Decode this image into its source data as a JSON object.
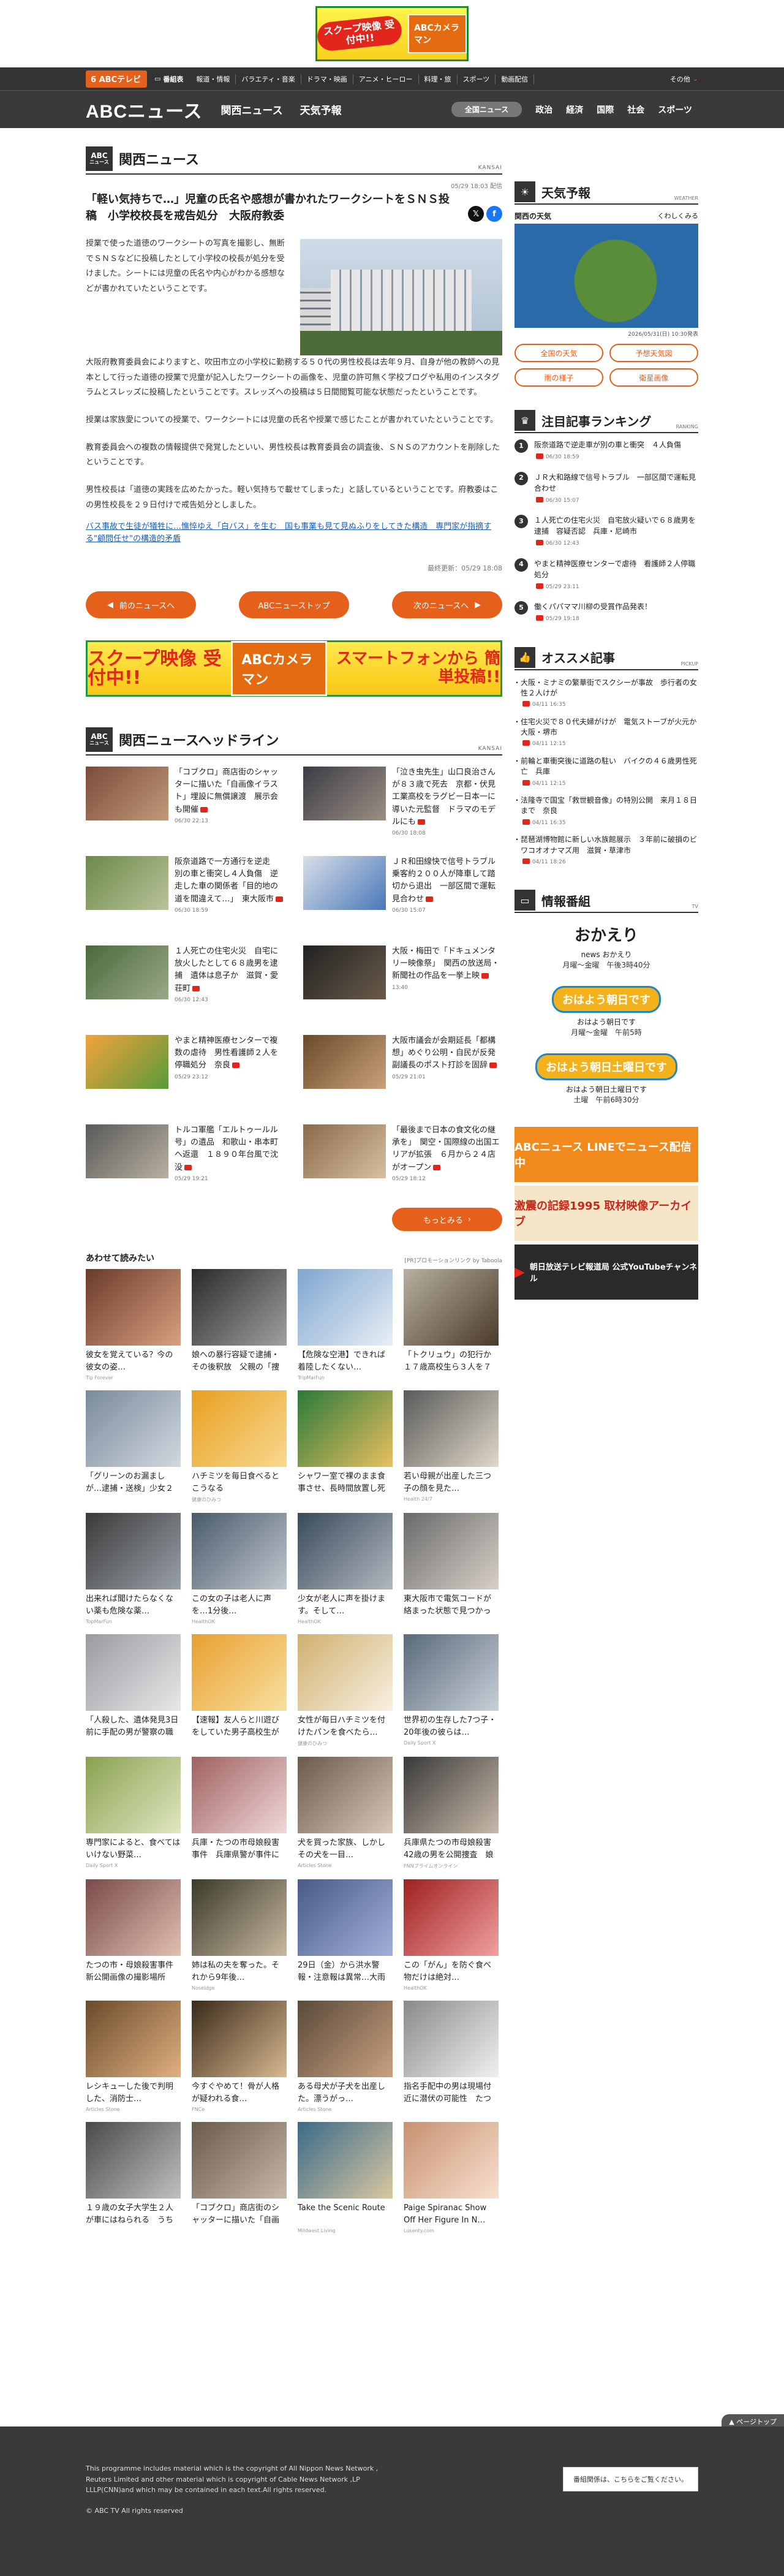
{
  "top_banner": {
    "badge": "スクープ映像 受付中!!",
    "brand": "ABCカメラマン"
  },
  "globalnav": {
    "logo": "6 ABCテレビ",
    "tv_label": "番組表",
    "items": [
      "報道・情報",
      "バラエティ・音楽",
      "ドラマ・映画",
      "アニメ・ヒーロー",
      "料理・旅",
      "スポーツ",
      "動画配信"
    ],
    "other": "その他"
  },
  "secnav": {
    "logo": "ABCニュース",
    "tabs": [
      "関西ニュース",
      "天気予報"
    ],
    "cats": [
      "全国ニュース",
      "政治",
      "経済",
      "国際",
      "社会",
      "スポーツ"
    ]
  },
  "article": {
    "section": "関西ニュース",
    "section_en": "KANSAI",
    "date": "05/29 18:03 配信",
    "title": "「軽い気持ちで…」児童の氏名や感想が書かれたワークシートをＳＮＳ投稿　小学校校長を戒告処分　大阪府教委",
    "p1": "授業で使った道徳のワークシートの写真を撮影し、無断でＳＮＳなどに投稿したとして小学校の校長が処分を受けました。シートには児童の氏名や内心がわかる感想などが書かれていたということです。",
    "p2": "大阪府教育委員会によりますと、吹田市立の小学校に勤務する５０代の男性校長は去年９月、自身が他の教師への見本として行った道徳の授業で児童が記入したワークシートの画像を、児童の許可無く学校ブログや私用のインスタグラムとスレッズに投稿したということです。スレッズへの投稿は５日間閲覧可能な状態だったということです。",
    "p3": "授業は家族愛についての授業で、ワークシートには児童の氏名や授業で感じたことが書かれていたということです。",
    "p4": "教育委員会への複数の情報提供で発覚したといい、男性校長は教育委員会の調査後、ＳＮＳのアカウントを削除したということです。",
    "p5": "男性校長は「道徳の実践を広めたかった。軽い気持ちで載せてしまった」と話しているということです。府教委はこの男性校長を２９日付けで戒告処分としました。",
    "related": "バス事故で生徒が犠牲に…憔悴ゆえ「白バス」を生む　国も事業も見て見ぬふりをしてきた構造　専門家が指摘する\"顧問任せ\"の構造的矛盾",
    "updated": "最終更新：05/29 18:08"
  },
  "pager": {
    "prev": "前のニュースへ",
    "top": "ABCニューストップ",
    "next": "次のニュースへ"
  },
  "banner2": {
    "a": "スクープ映像 受付中!!",
    "b": "ABCカメラマン",
    "c": "スマートフォンから 簡単投稿!!"
  },
  "headlines": {
    "title": "関西ニュースヘッドライン",
    "en": "KANSAI",
    "items": [
      {
        "text": "「コブクロ」商店街のシャッターに描いた「自画像イラスト」埋設に無償譲渡　展示会も開催",
        "date": "06/30 22:13"
      },
      {
        "text": "「泣き虫先生」山口良治さんが８３歳で死去　京都・伏見工業高校をラグビー日本一に導いた元監督　ドラマのモデルにも",
        "date": "06/30 18:08"
      },
      {
        "text": "阪奈道路で一方通行を逆走　別の車と衝突し４人負傷　逆走した車の関係者「目的地の道を間違えて…」　東大阪市",
        "date": "06/30 18:59"
      },
      {
        "text": "ＪＲ和田線快で信号トラブル　乗客約２００人が降車して踏切から退出　一部区間で運転見合わせ",
        "date": "06/30 15:07"
      },
      {
        "text": "１人死亡の住宅火災　自宅に放火したとして６８歳男を逮捕　遺体は息子か　滋賀・愛荘町",
        "date": "06/30 12:43"
      },
      {
        "text": "大阪・梅田で「ドキュメンタリー映像祭」　関西の放送局・新聞社の作品を一挙上映",
        "date": "13:40"
      },
      {
        "text": "やまと精神医療センターで複数の虐待　男性看護師２人を停職処分　奈良",
        "date": "05/29 23:12"
      },
      {
        "text": "大阪市議会が会期延長「都構想」めぐり公明・自民が反発　副議長のポスト打診を固辞",
        "date": "05/29 21:01"
      },
      {
        "text": "トルコ軍艦「エルトゥールル号」の遺品　和歌山・串本町へ返還　１８９０年台風で沈没",
        "date": "05/29 19:21"
      },
      {
        "text": "「最後まで日本の食文化の継承を」　関空・国際線の出国エリアが拡張　６月から２４店がオープン",
        "date": "05/29 18:12"
      }
    ],
    "more": "もっとみる"
  },
  "recommend": {
    "title": "あわせて読みたい",
    "pr": "[PR]プロモーションリンク by Taboola",
    "items": [
      {
        "cap": "彼女を覚えている？今の彼女の姿…",
        "src": "Tip Forever"
      },
      {
        "cap": "娘への暴行容疑で逮捕・その後釈放　父親の「捜査」全文",
        "src": ""
      },
      {
        "cap": "【危険な空港】できれば着陸したくない…",
        "src": "TripMarFun"
      },
      {
        "cap": "「トクリュウ」の犯行か　１７歳高校生ら３人を７０代女…",
        "src": ""
      },
      {
        "cap": "「グリーンのお漏ましが…逮捕・送検」少女２人に何…",
        "src": ""
      },
      {
        "cap": "ハチミツを毎日食べるとこうなる",
        "src": "健康のひみつ"
      },
      {
        "cap": "シャワー室で裸のまま食事させ、長時間放置し死亡させた…",
        "src": ""
      },
      {
        "cap": "若い母親が出産した三つ子の顔を見た…",
        "src": "Health 24/7"
      },
      {
        "cap": "出来れば聞けたらなくない薬も危険な薬…",
        "src": "TopMarFun"
      },
      {
        "cap": "この女の子は老人に声を…1分後…",
        "src": "HealthOK"
      },
      {
        "cap": "少女が老人に声を掛けます。そして…",
        "src": "HealthOK"
      },
      {
        "cap": "東大阪市で電気コードが絡まった状態で見つかった遺体の…",
        "src": ""
      },
      {
        "cap": "「人殺した、遺体発見3日前に手配の男が警察の職務質問…",
        "src": ""
      },
      {
        "cap": "【速報】友人らと川遊びをしていた男子高校生が死亡…",
        "src": ""
      },
      {
        "cap": "女性が毎日ハチミツを付けたパンを食べたら…",
        "src": "健康のひみつ"
      },
      {
        "cap": "世界初の生存した7つ子・20年後の彼らは…",
        "src": "Daily Sport X"
      },
      {
        "cap": "専門家によると、食べてはいけない野菜…",
        "src": "Daily Sport X"
      },
      {
        "cap": "兵庫・たつの市母娘殺害事件　兵庫県警が事件に公開した…",
        "src": ""
      },
      {
        "cap": "犬を買った家族、しかしその犬を一目…",
        "src": "Articles Stone"
      },
      {
        "cap": "兵庫県たつの市母娘殺害　42歳の男を公開捜査　娘への殺…",
        "src": "FNNプライムオンライン"
      },
      {
        "cap": "たつの市・母娘殺害事件　新公開画像の撮影場所は…",
        "src": ""
      },
      {
        "cap": "姉は私の夫を奪った。それから9年後…",
        "src": "Noseldge"
      },
      {
        "cap": "29日（金）から洪水警報・注意報は異常…大雨警報…",
        "src": ""
      },
      {
        "cap": "この「がん」を防ぐ食べ物だけは絶対…",
        "src": "HealthOK"
      },
      {
        "cap": "レシキューした後で判明した、消防士…",
        "src": "Articles Stone"
      },
      {
        "cap": "今すぐやめて！骨が人格が疑われる食…",
        "src": "FNCe"
      },
      {
        "cap": "ある母犬が子犬を出産した。漂うがっ…",
        "src": "Articles Stone"
      },
      {
        "cap": "指名手配中の男は現場付近に潜伏の可能性　たつの市母娘…",
        "src": ""
      },
      {
        "cap": "１９歳の女子大学生２人が車にはねられる　うち１人が重…",
        "src": ""
      },
      {
        "cap": "「コブクロ」商店街のシャッターに描いた「自画像イラス…",
        "src": ""
      },
      {
        "cap": "Take the Scenic Route",
        "src": "Mildwest Living"
      },
      {
        "cap": "Paige Spiranac Show Off Her Figure In N…",
        "src": "Lusenty.com"
      }
    ]
  },
  "weather": {
    "title": "天気予報",
    "en": "WEATHER",
    "area": "関西の天気",
    "link": "くわしくみる",
    "date": "2026/05/31(日) 10:30発表",
    "buttons": [
      "全国の天気",
      "予想天気図",
      "雨の様子",
      "衛星画像"
    ]
  },
  "ranking": {
    "title": "注目記事ランキング",
    "en": "RANKING",
    "items": [
      {
        "n": "1",
        "text": "阪奈道路で逆走車が別の車と衝突　４人負傷",
        "date": "06/30 18:59"
      },
      {
        "n": "2",
        "text": "ＪＲ大和路線で信号トラブル　一部区間で運転見合わせ",
        "date": "06/30 15:07"
      },
      {
        "n": "3",
        "text": "１人死亡の住宅火災　自宅放火疑いで６８歳男を逮捕　容疑否認　兵庫・尼崎市",
        "date": "06/30 12:43"
      },
      {
        "n": "4",
        "text": "やまと精神医療センターで虐待　看護師２人停職処分",
        "date": "05/29 23:11"
      },
      {
        "n": "5",
        "text": "働くパパママ川柳の受賞作品発表！",
        "date": "05/29 19:18"
      }
    ]
  },
  "picks": {
    "title": "オススメ記事",
    "en": "PICKUP",
    "items": [
      {
        "text": "大阪・ミナミの繁華街でスクシーが事故　歩行者の女性２人けが",
        "date": "04/11 16:35"
      },
      {
        "text": "住宅火災で８０代夫婦がけが　電気ストーブが火元か　大阪・堺市",
        "date": "04/11 12:15"
      },
      {
        "text": "前輪と車衝突後に道路の駐い　バイクの４６歳男性死亡　兵庫",
        "date": "04/11 12:15"
      },
      {
        "text": "法隆寺で国宝「救世観音像」の特別公開　来月１８日まで　奈良",
        "date": "04/11 16:35"
      },
      {
        "text": "琵琶湖博物館に新しい水族館展示　３年前に破損のビワコオオナマズ用　滋賀・草津市",
        "date": "04/11 18:26"
      }
    ]
  },
  "programs": {
    "title": "情報番組",
    "en": "TV",
    "items": [
      {
        "logo": "おかえり",
        "name": "news おかえり",
        "slot": "月曜～金曜　午後3時40分"
      },
      {
        "logo": "おはよう朝日です",
        "name": "おはよう朝日です",
        "slot": "月曜～金曜　午前5時"
      },
      {
        "logo": "おはよう朝日土曜日です",
        "name": "おはよう朝日土曜日です",
        "slot": "土曜　午前6時30分"
      }
    ]
  },
  "side_banners": [
    "ABCニュース LINEでニュース配信中",
    "激震の記録1995 取材映像アーカイブ",
    "朝日放送テレビ報道局 公式YouTubeチャンネル"
  ],
  "footer": {
    "l1": "This programme includes material which is the copyright of All Nippon News Network ,",
    "l2": "Reuters Limited and other material which is copyright of Cable News Network ,LP",
    "l3": "LLLP(CNN)and which may be contained in each text.All rights reserved.",
    "copy": "© ABC TV All rights reserved",
    "box": "番組関係は、こちらをご覧ください。",
    "pagetop": "ページトップ"
  }
}
